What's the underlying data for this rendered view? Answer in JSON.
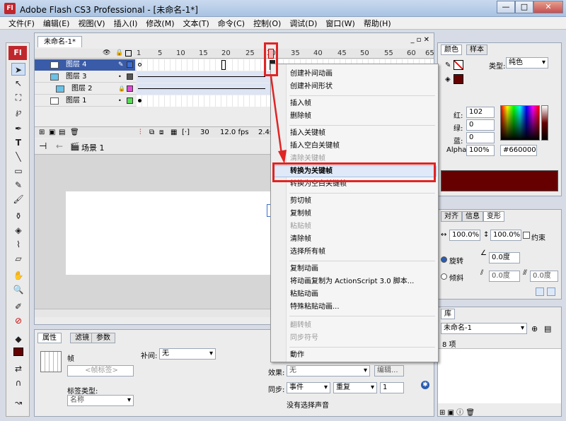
{
  "window": {
    "title": "Adobe Flash CS3 Professional - [未命名-1*]",
    "app_icon": "Fl",
    "buttons": [
      "—",
      "□",
      "✕"
    ]
  },
  "menubar": [
    "文件(F)",
    "编辑(E)",
    "视图(V)",
    "插入(I)",
    "修改(M)",
    "文本(T)",
    "命令(C)",
    "控制(O)",
    "调试(D)",
    "窗口(W)",
    "帮助(H)"
  ],
  "toolbar": {
    "logo": "Fl"
  },
  "document": {
    "tab": "未命名-1*",
    "ruler": [
      "1",
      "5",
      "10",
      "15",
      "20",
      "25",
      "30",
      "35",
      "40",
      "45",
      "50",
      "55",
      "60",
      "65"
    ],
    "layers": [
      {
        "name": "图层 4",
        "color": "#3b6fd6",
        "selected": true
      },
      {
        "name": "图层 3",
        "color": "#555555",
        "selected": false
      },
      {
        "name": "图层 2",
        "color": "#e04bd6",
        "selected": false
      },
      {
        "name": "图层 1",
        "color": "#55dd55",
        "selected": false
      }
    ],
    "status": {
      "frame": "30",
      "fps": "12.0 fps",
      "time": "2.4s"
    },
    "scene": "场景 1"
  },
  "context_menu": {
    "items": [
      {
        "label": "创建补间动画",
        "disabled": false
      },
      {
        "label": "创建补间形状",
        "disabled": false
      },
      {
        "sep": true
      },
      {
        "label": "插入帧",
        "disabled": false
      },
      {
        "label": "删除帧",
        "disabled": false
      },
      {
        "sep": true
      },
      {
        "label": "插入关键帧",
        "disabled": false
      },
      {
        "label": "插入空白关键帧",
        "disabled": false
      },
      {
        "label": "清除关键帧",
        "disabled": true
      },
      {
        "label": "转换为关键帧",
        "disabled": false,
        "highlighted": true
      },
      {
        "label": "转换为空白关键帧",
        "disabled": false
      },
      {
        "sep": true
      },
      {
        "label": "剪切帧",
        "disabled": false
      },
      {
        "label": "复制帧",
        "disabled": false
      },
      {
        "label": "粘贴帧",
        "disabled": true
      },
      {
        "label": "清除帧",
        "disabled": false
      },
      {
        "label": "选择所有帧",
        "disabled": false
      },
      {
        "sep": true
      },
      {
        "label": "复制动画",
        "disabled": false
      },
      {
        "label": "将动画复制为 ActionScript 3.0 脚本...",
        "disabled": false
      },
      {
        "label": "粘贴动画",
        "disabled": false
      },
      {
        "label": "特殊粘贴动画...",
        "disabled": false
      },
      {
        "sep": true
      },
      {
        "label": "翻转帧",
        "disabled": true
      },
      {
        "label": "同步符号",
        "disabled": true
      },
      {
        "sep": true
      },
      {
        "label": "動作",
        "disabled": false
      }
    ]
  },
  "properties": {
    "tabs": [
      "属性",
      "滤镜",
      "参数"
    ],
    "frame_label": "帧",
    "frame_name_placeholder": "<帧标签>",
    "tween_label": "补间:",
    "tween_value": "无",
    "label_type_label": "标签类型:",
    "label_type_value": "名称",
    "effect_label": "效果:",
    "effect_value": "无",
    "edit_button": "编辑...",
    "sync_label": "同步:",
    "sync_value": "事件",
    "repeat_value": "重复",
    "repeat_count": "1",
    "no_sound": "没有选择声音"
  },
  "color_panel": {
    "tabs": [
      "颜色",
      "样本"
    ],
    "type_label": "类型:",
    "type_value": "纯色",
    "red_label": "红:",
    "red": "102",
    "green_label": "绿:",
    "green": "0",
    "blue_label": "蓝:",
    "blue": "0",
    "alpha_label": "Alpha:",
    "alpha": "100%",
    "hex": "#660000",
    "swatch_color": "#660000"
  },
  "transform_panel": {
    "tabs": [
      "对齐",
      "信息",
      "变形"
    ],
    "width_pct": "100.0%",
    "height_pct": "100.0%",
    "constrain": "约束",
    "rotate_label": "旋转",
    "rotate_value": "0.0度",
    "skew_label": "倾斜",
    "skew_value1": "0.0度",
    "skew_value2": "0.0度"
  },
  "library_panel": {
    "tabs": [
      "库"
    ],
    "doc": "未命名-1",
    "count": "8 项"
  },
  "annotation_color": "#e02424"
}
